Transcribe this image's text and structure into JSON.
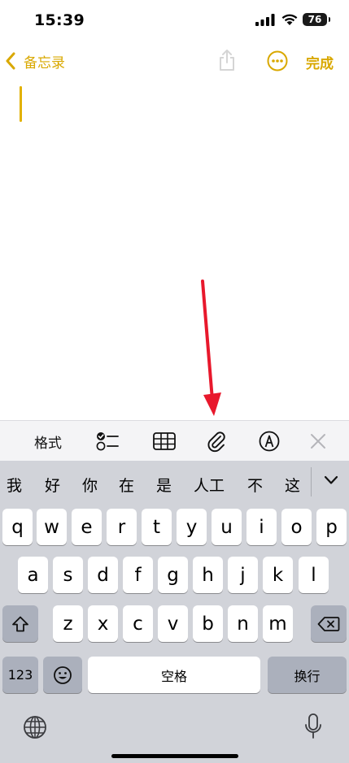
{
  "status_bar": {
    "time": "15:39",
    "battery_level": "76"
  },
  "nav": {
    "back_label": "备忘录",
    "done_label": "完成"
  },
  "toolbar": {
    "format_label": "格式"
  },
  "candidates": [
    {
      "text": "我"
    },
    {
      "text": "好"
    },
    {
      "text": "你"
    },
    {
      "text": "在"
    },
    {
      "text": "是"
    },
    {
      "text": "人工"
    },
    {
      "text": "不"
    },
    {
      "text": "这"
    }
  ],
  "keyboard": {
    "row1": [
      "q",
      "w",
      "e",
      "r",
      "t",
      "y",
      "u",
      "i",
      "o",
      "p"
    ],
    "row2": [
      "a",
      "s",
      "d",
      "f",
      "g",
      "h",
      "j",
      "k",
      "l"
    ],
    "row3": [
      "z",
      "x",
      "c",
      "v",
      "b",
      "n",
      "m"
    ],
    "numbers_label": "123",
    "space_label": "空格",
    "return_label": "换行"
  },
  "colors": {
    "accent": "#d9a800",
    "annotation_arrow": "#e8182c",
    "keyboard_bg": "#d1d3d9"
  }
}
